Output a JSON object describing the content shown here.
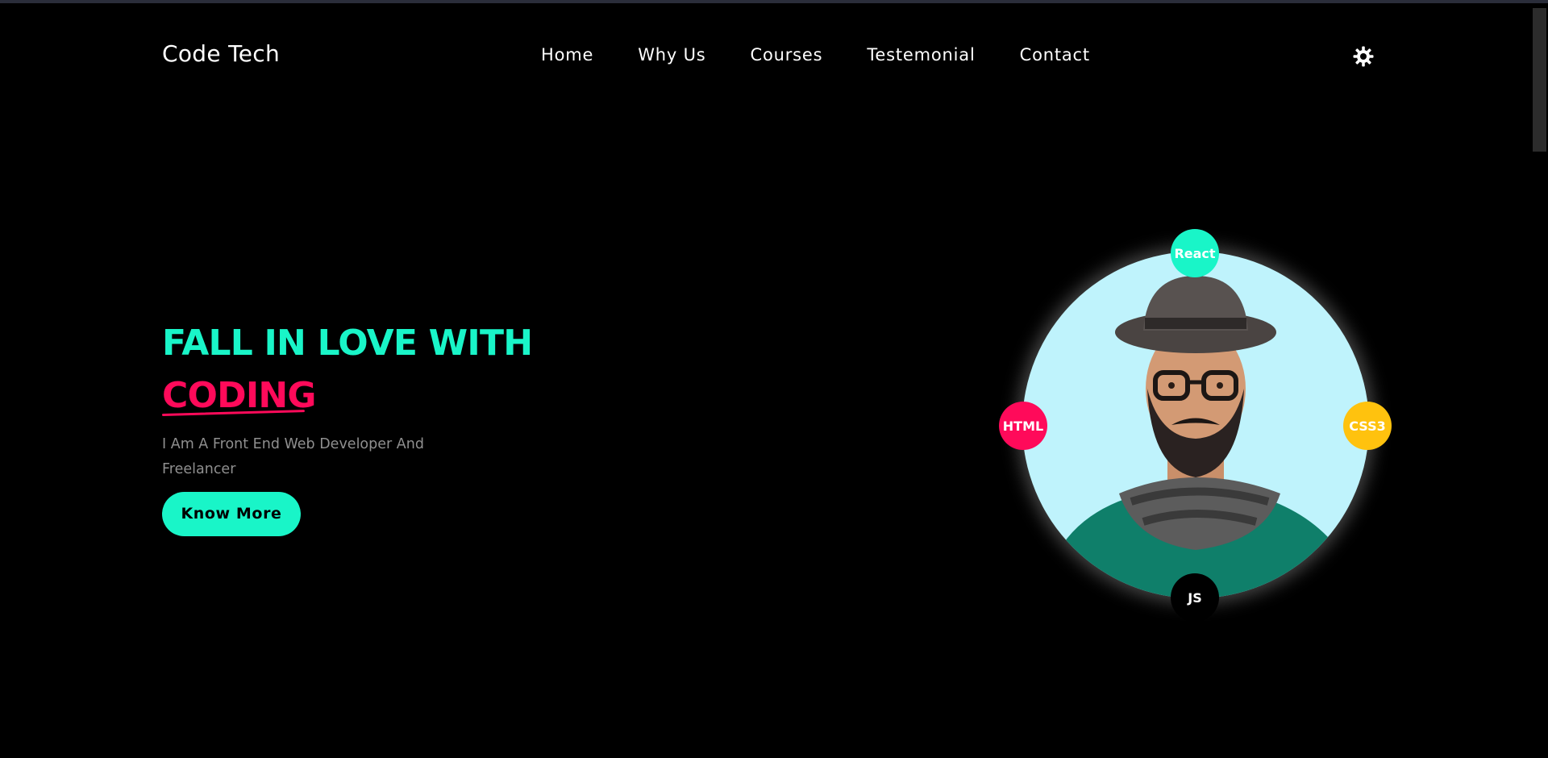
{
  "brand": {
    "name": "Code Tech"
  },
  "nav": {
    "items": [
      "Home",
      "Why Us",
      "Courses",
      "Testemonial",
      "Contact"
    ]
  },
  "theme_toggle": {
    "icon": "sun-icon"
  },
  "hero": {
    "title_line1": "FALL IN LOVE WITH",
    "title_line2": "CODING",
    "subtitle": "I Am A Front End Web Developer And Freelancer",
    "cta": "Know More"
  },
  "skills": [
    "React",
    "HTML",
    "CSS3",
    "JS"
  ],
  "colors": {
    "background": "#000000",
    "accent_cyan": "#19f5c8",
    "accent_pink": "#ff0a5a",
    "accent_yellow": "#ffc20e",
    "photo_bg": "#bff3fc",
    "subtitle_gray": "#8f8f8f"
  }
}
